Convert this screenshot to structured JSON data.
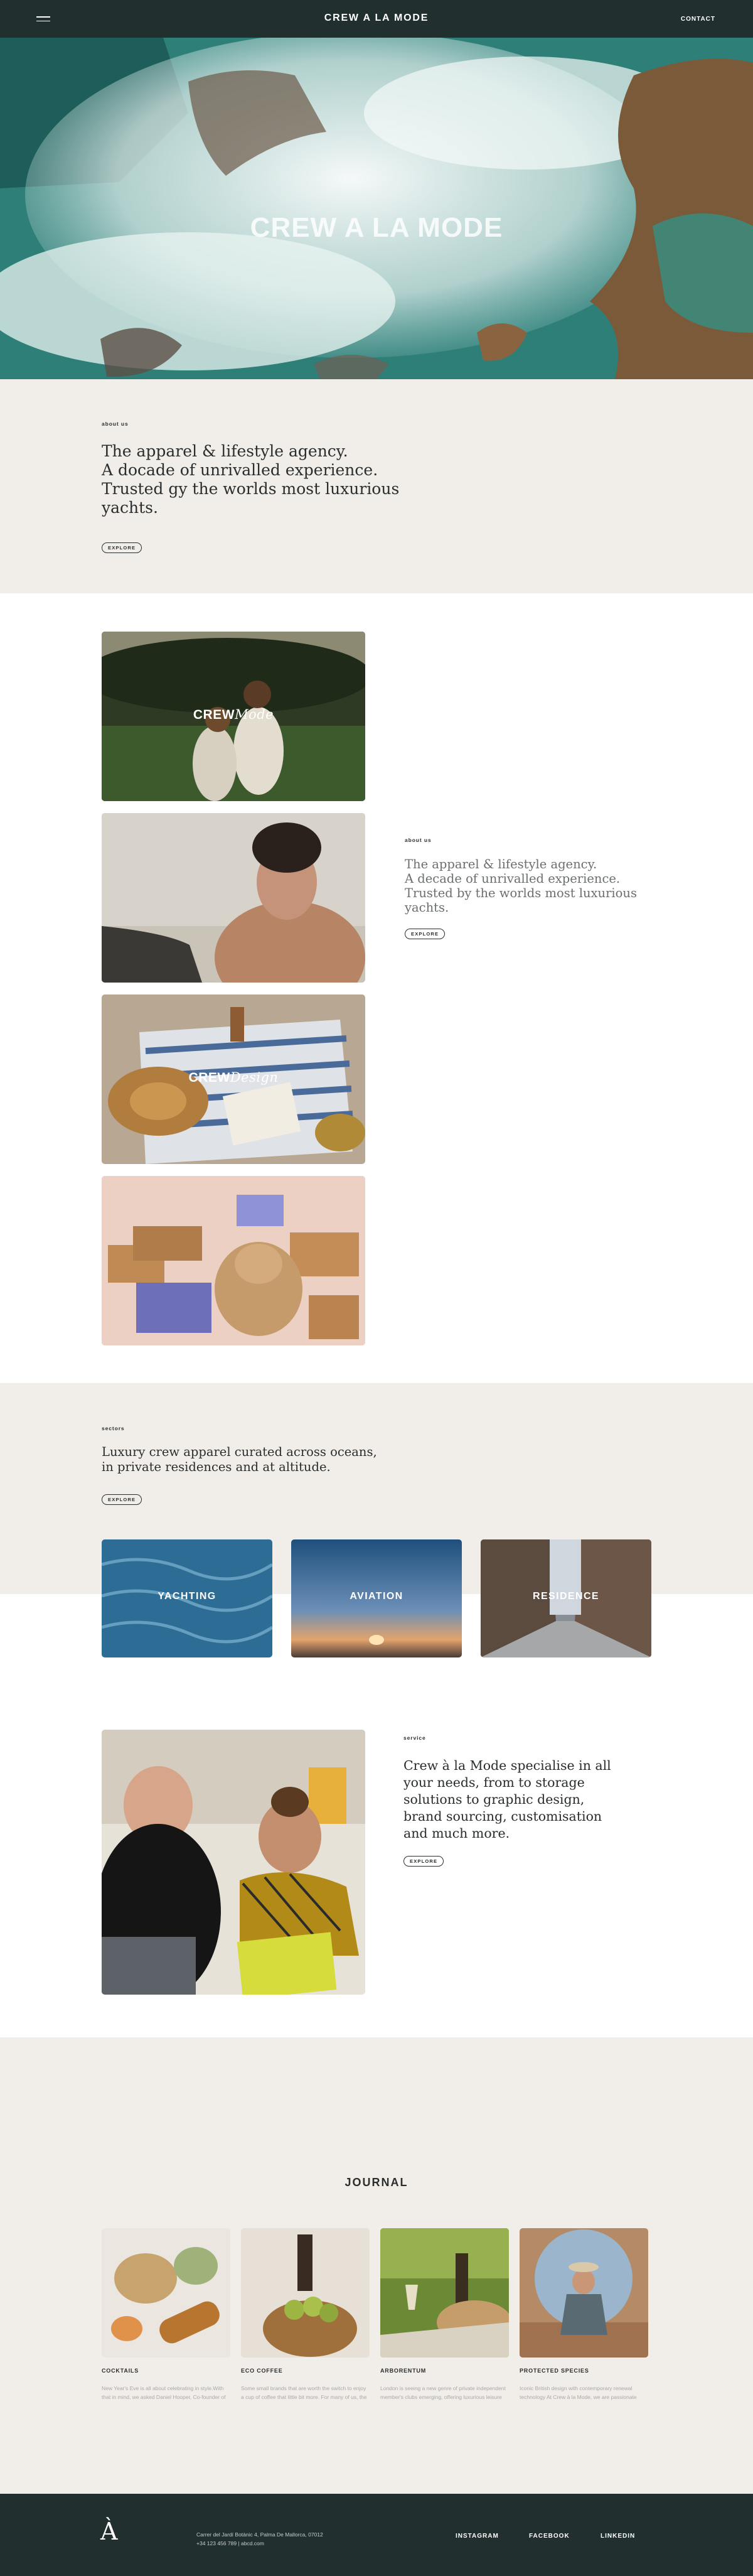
{
  "header": {
    "brand": "CREW A LA MODE",
    "contact": "CONTACT"
  },
  "hero": {
    "title": "CREW A LA MODE"
  },
  "about": {
    "label": "about us",
    "lead": "The apparel & lifestyle agency.\nA docade of unrivalled experience.\nTrusted gy the worlds most luxurious yachts.",
    "button": "EXPLORE"
  },
  "gallery": {
    "cards": [
      {
        "brand": "CREW",
        "script": "Mode"
      },
      {
        "brand": "",
        "script": ""
      },
      {
        "brand": "CREW",
        "script": "Design"
      },
      {
        "brand": "",
        "script": ""
      }
    ],
    "about": {
      "label": "about us",
      "lead": "The apparel & lifestyle agency.\nA decade of unrivalled experience.\nTrusted by the worlds most luxurious yachts.",
      "button": "EXPLORE"
    }
  },
  "sectors": {
    "label": "sectors",
    "lead": "Luxury crew apparel curated across oceans,\nin private residences and at altitude.",
    "button": "EXPLORE",
    "tiles": [
      "YACHTING",
      "AVIATION",
      "RESIDENCE"
    ]
  },
  "service": {
    "label": "service",
    "lead": "Crew à la Mode specialise in all your needs, from to storage solutions to graphic design, brand sourcing, customisation and much more.",
    "button": "EXPLORE"
  },
  "journal": {
    "title": "JOURNAL",
    "posts": [
      {
        "name": "COCKTAILS",
        "desc": "New Year's Eve is all about celebrating in style.With that in mind, we asked Daniel Hooper, Co-founder of Yorkhire drink..."
      },
      {
        "name": "ECO COFFEE",
        "desc": "Some small brands that are worth the switch to enjoy a cup of coffee that little bit more. For many of us, the need for..."
      },
      {
        "name": "ARBORENTUM",
        "desc": "London is seeing a new genre of private independent member's clubs emerging, offering luxurious leisure and servic..."
      },
      {
        "name": "PROTECTED SPECIES",
        "desc": "Iconic British design with contemporary renewal technology At Crew à la Mode, we are passionate about sustainabili..."
      }
    ]
  },
  "footer": {
    "logo": "À",
    "address_line1": "Carrer del Jardí Botànic 4, Palma De Mallorca, 07012",
    "address_line2": "+34 123 456 789 | abcd.com",
    "links": [
      "INSTAGRAM",
      "FACEBOOK",
      "LINKEDIN"
    ]
  }
}
